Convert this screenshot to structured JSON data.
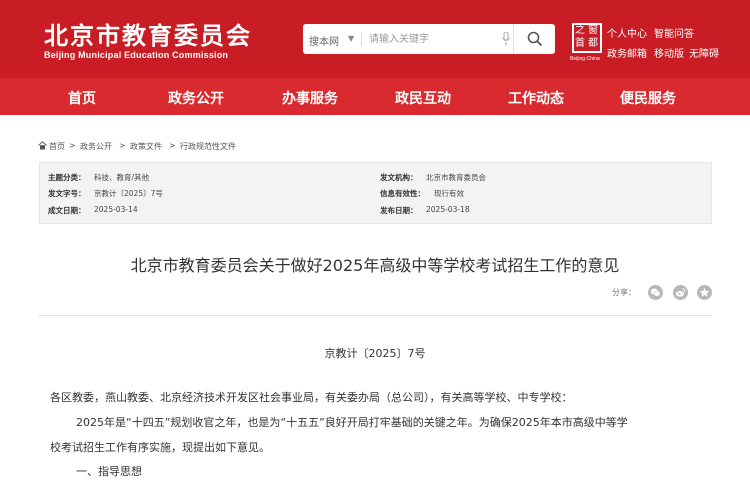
{
  "header": {
    "logo_cn": "北京市教育委员会",
    "logo_en": "Beijing Municipal Education Commission",
    "search": {
      "scope": "搜本网",
      "placeholder": "请输入关键字"
    },
    "emblem": {
      "chars": [
        "之",
        "首",
        "窗",
        "都"
      ],
      "caption": "Beijing·China"
    },
    "links": [
      "个人中心",
      "智能问答",
      "政务邮箱",
      "移动版",
      "无障碍"
    ]
  },
  "nav": [
    "首页",
    "政务公开",
    "办事服务",
    "政民互动",
    "工作动态",
    "便民服务"
  ],
  "breadcrumb": [
    "首页",
    ">",
    "政务公开",
    ">",
    "政策文件",
    ">",
    "行政规范性文件"
  ],
  "meta": {
    "topic_label": "主题分类：",
    "topic": "科技、教育/其他",
    "docno_label": "发文字号：",
    "docno": "京教计〔2025〕7号",
    "date_label": "成文日期：",
    "date": "2025-03-14",
    "issuer_label": "发文机构：",
    "issuer": "北京市教育委员会",
    "validity_label": "信息有效性：",
    "validity": "现行有效",
    "pub_label": "发布日期：",
    "pub": "2025-03-18"
  },
  "article": {
    "title": "北京市教育委员会关于做好2025年高级中等学校考试招生工作的意见",
    "share_label": "分享：",
    "doc_number": "京教计〔2025〕7号",
    "addressee": "各区教委，燕山教委、北京经济技术开发区社会事业局，有关委办局（总公司），有关高等学校、中专学校：",
    "intro_line1": "2025年是“十四五”规划收官之年，也是为“十五五”良好开局打牢基础的关键之年。为确保2025年本市高级中等学",
    "intro_line2": "校考试招生工作有序实施，现提出如下意见。",
    "section1": "一、指导思想"
  },
  "colors": {
    "header_red": "#c81d25",
    "nav_red": "#d82a2f",
    "meta_bg": "#f3f3f3"
  }
}
